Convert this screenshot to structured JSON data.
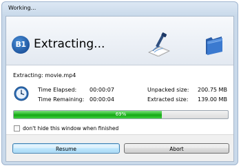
{
  "window": {
    "title": "Working..."
  },
  "header": {
    "logo_text": "B1",
    "title": "Extracting...",
    "extract_icon": "archive-extract-icon",
    "folder_icon": "blue-folder-icon"
  },
  "file": {
    "line": "Extracting: movie.mp4"
  },
  "stats": {
    "clock_icon": "clock-icon",
    "time_elapsed_label": "Time Elapsed:",
    "time_elapsed_value": "00:00:07",
    "time_remaining_label": "Time Remaining:",
    "time_remaining_value": "00:00:04",
    "unpacked_size_label": "Unpacked size:",
    "unpacked_size_value": "200.75 MB",
    "extracted_size_label": "Extracted size:",
    "extracted_size_value": "139.00 MB"
  },
  "progress": {
    "percent": 69,
    "label": "69%",
    "color": "#1fb51f"
  },
  "options": {
    "dont_hide_checked": false,
    "dont_hide_label": "don't hide this window when finished"
  },
  "buttons": {
    "resume_label": "Resume",
    "abort_label": "Abort"
  }
}
